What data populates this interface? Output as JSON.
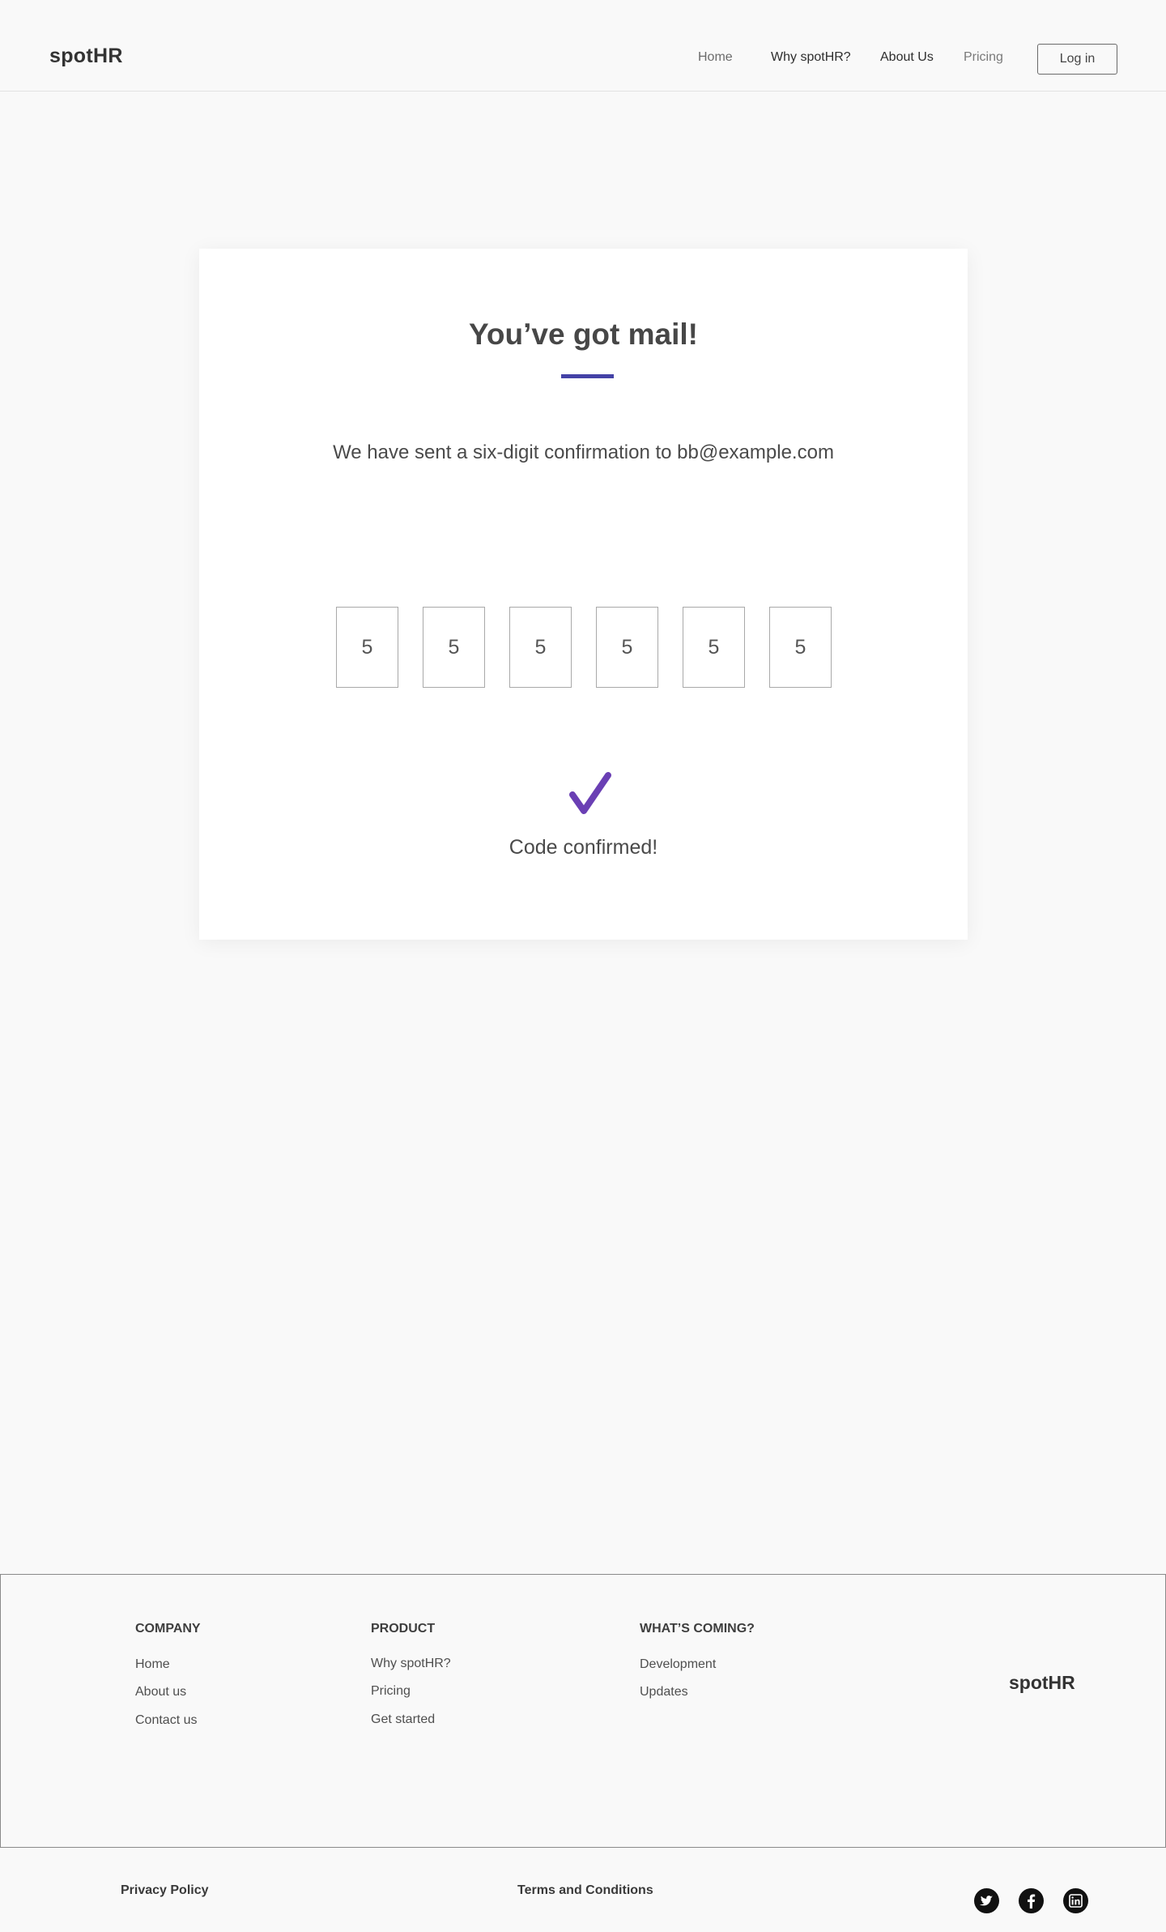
{
  "header": {
    "logo": "spotHR",
    "nav": [
      "Home",
      "Why spotHR?",
      "About Us",
      "Pricing"
    ],
    "login_label": "Log in"
  },
  "card": {
    "title": "You’ve got mail!",
    "subtitle": "We have sent a six-digit confirmation to bb@example.com",
    "code_digits": [
      "5",
      "5",
      "5",
      "5",
      "5",
      "5"
    ],
    "confirm_text": "Code confirmed!",
    "check_icon": "checkmark-icon",
    "accent_color": "#4442a6",
    "check_color": "#6a3fb4"
  },
  "footer": {
    "columns": [
      {
        "heading": "COMPANY",
        "links": [
          "Home",
          "About us",
          "Contact us"
        ]
      },
      {
        "heading": "PRODUCT",
        "links": [
          "Why spotHR?",
          "Pricing",
          "Get started"
        ]
      },
      {
        "heading": "WHAT’S COMING?",
        "links": [
          "Development",
          "Updates"
        ]
      }
    ],
    "logo": "spotHR"
  },
  "bottom_bar": {
    "privacy": "Privacy Policy",
    "terms": "Terms and Conditions",
    "social_icons": [
      "twitter-icon",
      "facebook-icon",
      "linkedin-icon"
    ]
  }
}
